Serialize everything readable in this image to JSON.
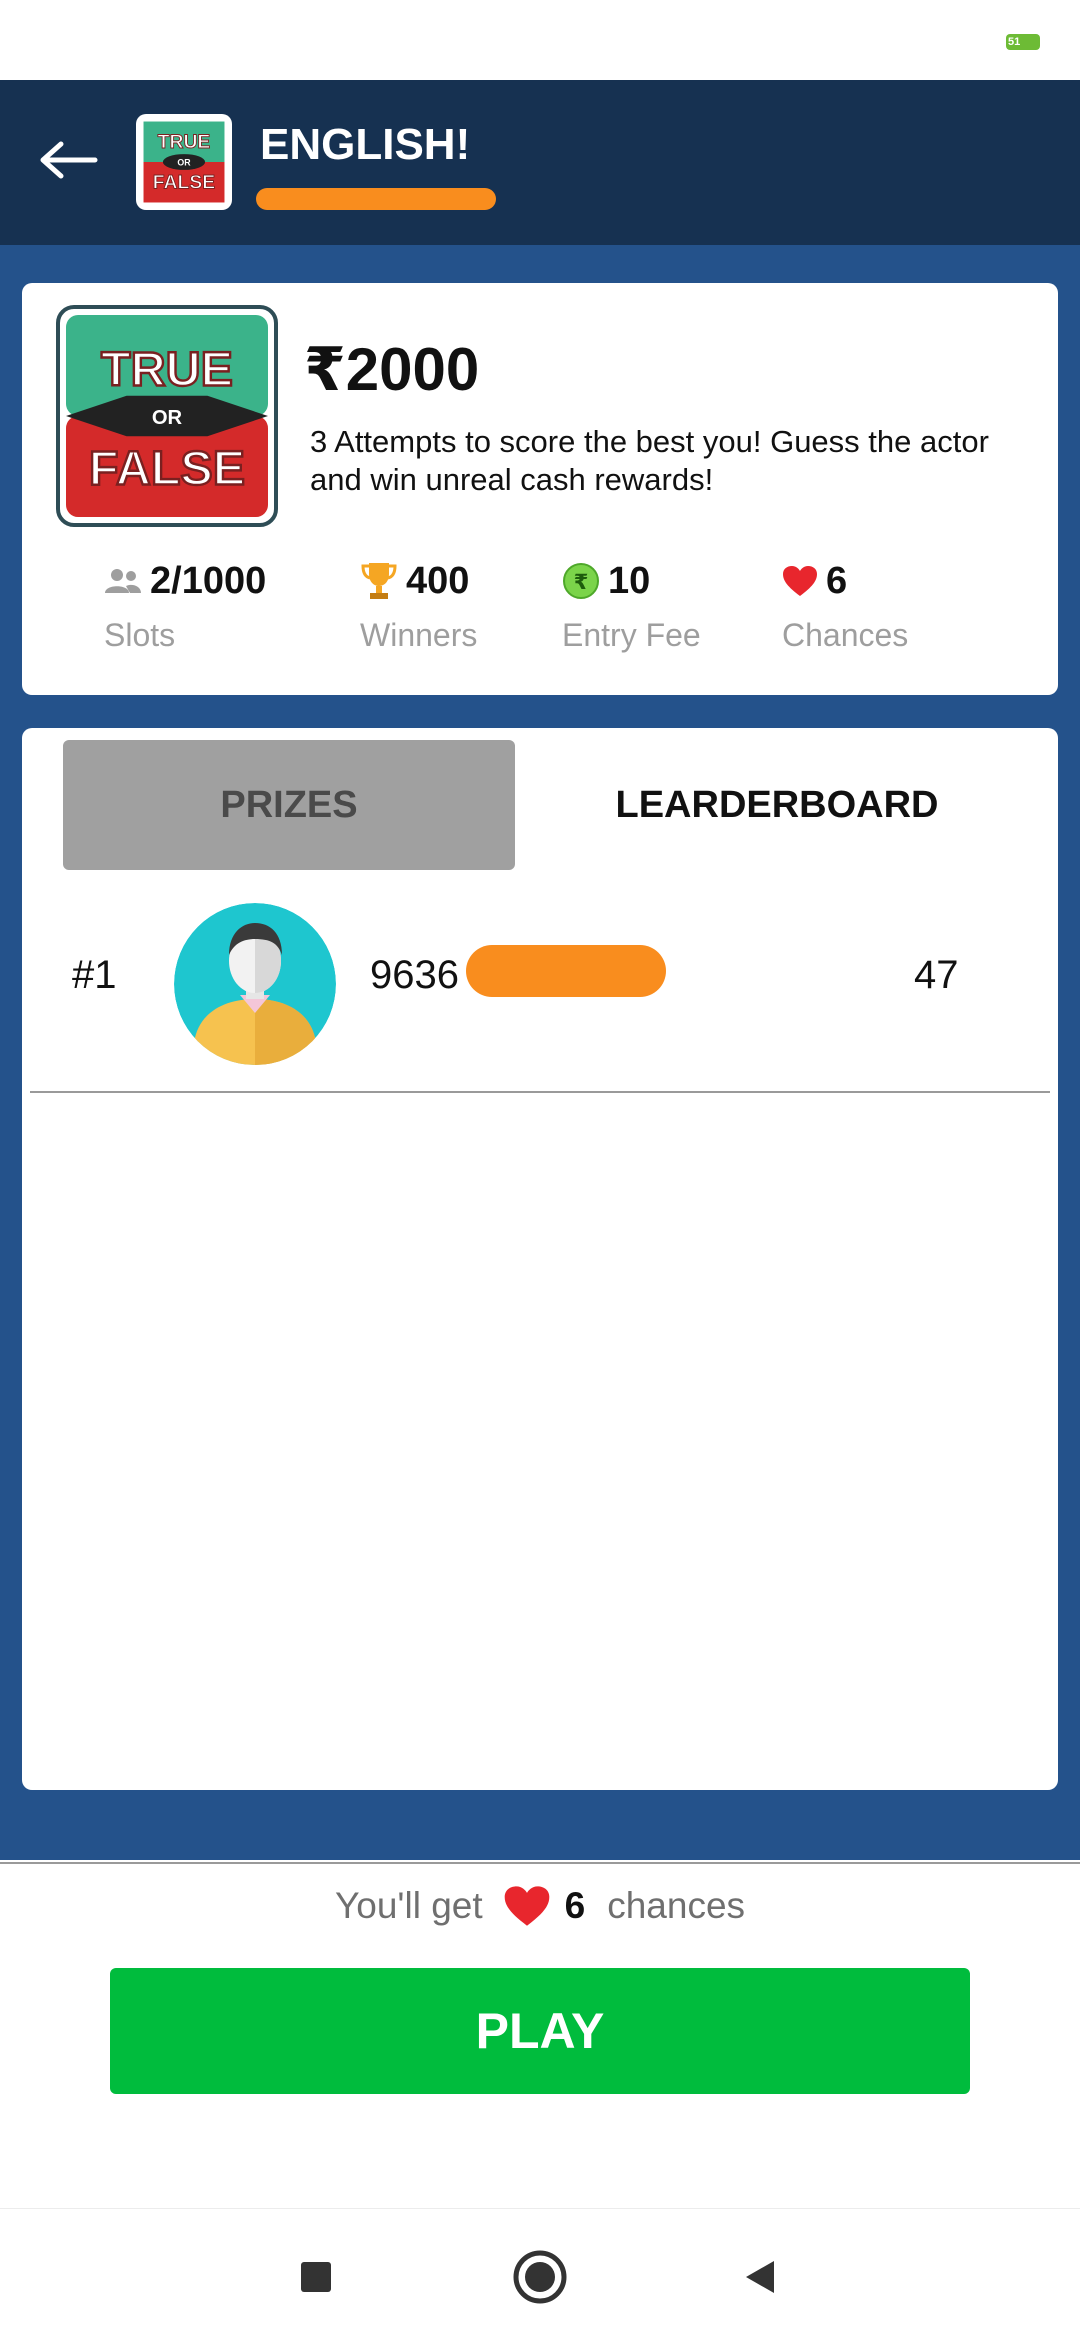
{
  "header": {
    "title": "ENGLISH!",
    "logo_top": "TRUE",
    "logo_mid": "OR",
    "logo_bottom": "FALSE"
  },
  "contest": {
    "prize": "₹2000",
    "description": "3 Attempts to score the best you! Guess the actor and win unreal cash rewards!",
    "stats": [
      {
        "value": "2/1000",
        "label": "Slots",
        "icon": "people-icon"
      },
      {
        "value": "400",
        "label": "Winners",
        "icon": "trophy-icon"
      },
      {
        "value": "10",
        "label": "Entry Fee",
        "icon": "rupee-coin-icon"
      },
      {
        "value": "6",
        "label": "Chances",
        "icon": "heart-icon"
      }
    ]
  },
  "tabs": {
    "prizes": "PRIZES",
    "leaderboard": "LEARDERBOARD"
  },
  "leaderboard": [
    {
      "rank": "#1",
      "phone": "9636",
      "score": "47"
    }
  ],
  "footer": {
    "prefix": "You'll get",
    "chances": "6",
    "suffix": "chances",
    "play": "PLAY"
  },
  "colors": {
    "header_bg": "#163151",
    "main_bg": "#24528b",
    "play_green": "#00bc3d",
    "redaction": "#f98d1e",
    "heart": "#e8262d"
  }
}
